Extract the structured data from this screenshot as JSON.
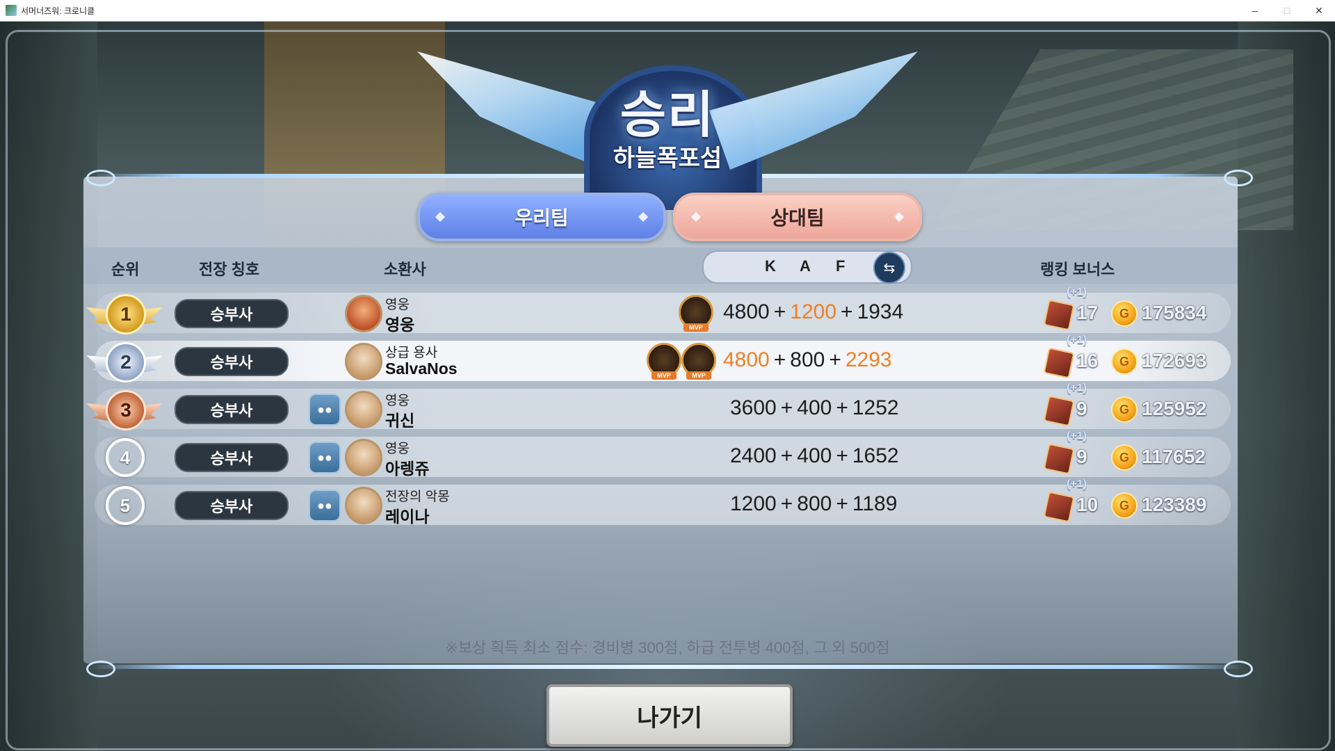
{
  "window": {
    "title": "서머너즈워: 크로니클",
    "min_glyph": "–",
    "max_glyph": "□",
    "close_glyph": "✕"
  },
  "header": {
    "result": "승리",
    "map": "하늘폭포섬"
  },
  "tabs": {
    "our_team": "우리팀",
    "opponent_team": "상대팀",
    "active": "our_team"
  },
  "columns": {
    "rank": "순위",
    "battle_title": "전장 칭호",
    "summoner": "소환사",
    "k": "K",
    "a": "A",
    "f": "F",
    "ranking_bonus": "랭킹 보너스"
  },
  "rows": [
    {
      "rank": "1",
      "title": "승부사",
      "summoner_title": "영웅",
      "summoner_name": "영웅",
      "k": "4800",
      "a": "1200",
      "f": "1934",
      "highlight": [
        "a"
      ],
      "mvp_count": 1,
      "bonus_plus": "(+1)",
      "bonus_boxes": "17",
      "coins": "175834"
    },
    {
      "rank": "2",
      "title": "승부사",
      "summoner_title": "상급 용사",
      "summoner_name": "SalvaNos",
      "k": "4800",
      "a": "800",
      "f": "2293",
      "highlight": [
        "k",
        "f"
      ],
      "mvp_count": 2,
      "bonus_plus": "(+1)",
      "bonus_boxes": "16",
      "coins": "172693"
    },
    {
      "rank": "3",
      "title": "승부사",
      "summoner_title": "영웅",
      "summoner_name": "귀신",
      "k": "3600",
      "a": "400",
      "f": "1252",
      "highlight": [],
      "mvp_count": 0,
      "bonus_plus": "(+1)",
      "bonus_boxes": "9",
      "coins": "125952"
    },
    {
      "rank": "4",
      "title": "승부사",
      "summoner_title": "영웅",
      "summoner_name": "아렝쥬",
      "k": "2400",
      "a": "400",
      "f": "1652",
      "highlight": [],
      "mvp_count": 0,
      "bonus_plus": "(+1)",
      "bonus_boxes": "9",
      "coins": "117652"
    },
    {
      "rank": "5",
      "title": "승부사",
      "summoner_title": "전장의 악몽",
      "summoner_name": "레이나",
      "k": "1200",
      "a": "800",
      "f": "1189",
      "highlight": [],
      "mvp_count": 0,
      "bonus_plus": "(+1)",
      "bonus_boxes": "10",
      "coins": "123389"
    }
  ],
  "mvp_label": "MVP",
  "plus_sign": "+",
  "footer_note": "※보상 획득 최소 점수: 경비병 300점, 하급 전투병 400점, 그 외 500점",
  "exit_button": "나가기",
  "colors": {
    "highlight": "#f08020",
    "our_tab": "#6f8ff0",
    "opp_tab": "#f2b2a6"
  },
  "icons": {
    "swap": "swap-arrows-icon",
    "party": "party-members-icon",
    "reward_box": "reward-box-icon",
    "coin": "gold-coin-icon",
    "mvp": "mvp-medal-icon"
  }
}
